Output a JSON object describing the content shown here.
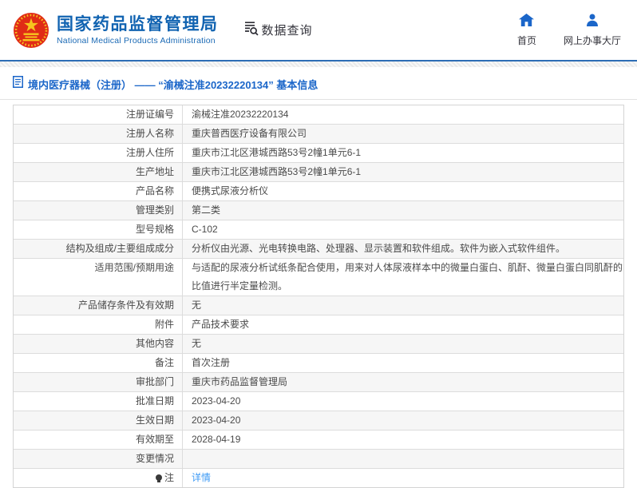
{
  "header": {
    "title": "国家药品监督管理局",
    "subtitle": "National Medical Products Administration",
    "data_query_label": "数据查询",
    "nav": {
      "home": "首页",
      "service_hall": "网上办事大厅"
    }
  },
  "breadcrumb": {
    "text": "境内医疗器械（注册） —— “渝械注准20232220134” 基本信息"
  },
  "table": {
    "rows": [
      {
        "label": "注册证编号",
        "value": "渝械注准20232220134"
      },
      {
        "label": "注册人名称",
        "value": "重庆普西医疗设备有限公司"
      },
      {
        "label": "注册人住所",
        "value": "重庆市江北区港城西路53号2幢1单元6-1"
      },
      {
        "label": "生产地址",
        "value": "重庆市江北区港城西路53号2幢1单元6-1"
      },
      {
        "label": "产品名称",
        "value": "便携式尿液分析仪"
      },
      {
        "label": "管理类别",
        "value": "第二类"
      },
      {
        "label": "型号规格",
        "value": "C-102"
      },
      {
        "label": "结构及组成/主要组成成分",
        "value": "分析仪由光源、光电转换电路、处理器、显示装置和软件组成。软件为嵌入式软件组件。"
      },
      {
        "label": "适用范围/预期用途",
        "value": "与适配的尿液分析试纸条配合使用，用来对人体尿液样本中的微量白蛋白、肌酐、微量白蛋白同肌酐的比值进行半定量检测。"
      },
      {
        "label": "产品储存条件及有效期",
        "value": "无"
      },
      {
        "label": "附件",
        "value": "产品技术要求"
      },
      {
        "label": "其他内容",
        "value": "无"
      },
      {
        "label": "备注",
        "value": "首次注册"
      },
      {
        "label": "审批部门",
        "value": "重庆市药品监督管理局"
      },
      {
        "label": "批准日期",
        "value": "2023-04-20"
      },
      {
        "label": "生效日期",
        "value": "2023-04-20"
      },
      {
        "label": "有效期至",
        "value": "2028-04-19"
      },
      {
        "label": "变更情况",
        "value": ""
      },
      {
        "label": "注",
        "value": "详情",
        "link": true,
        "icon": "bulb-icon"
      }
    ]
  },
  "colors": {
    "brand_blue": "#1163b1",
    "divider_blue": "#2d6db5",
    "breadcrumb_blue": "#1b66c9",
    "link_blue": "#3d9af5",
    "row_alt_gray": "#f6f6f6",
    "emblem_red": "#e02b16",
    "emblem_gold": "#f6c51e"
  }
}
